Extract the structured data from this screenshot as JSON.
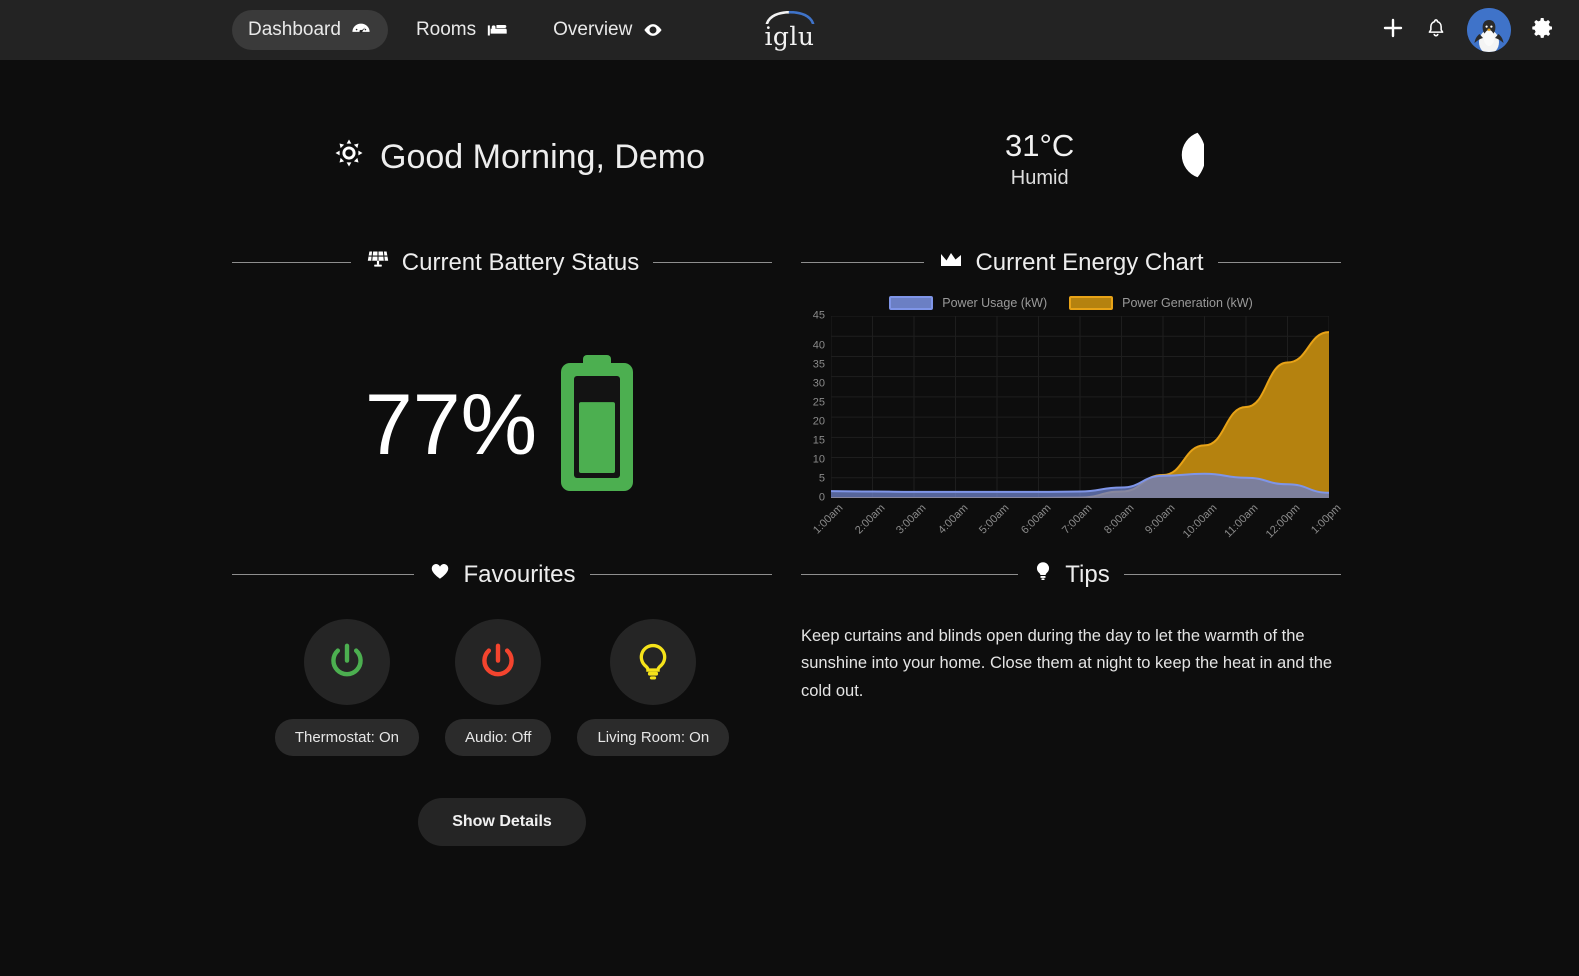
{
  "topbar": {
    "nav": [
      {
        "label": "Dashboard",
        "icon": "gauge-icon",
        "active": true
      },
      {
        "label": "Rooms",
        "icon": "bed-icon",
        "active": false
      },
      {
        "label": "Overview",
        "icon": "eye-icon",
        "active": false
      }
    ],
    "logo_text": "iglu",
    "actions": [
      {
        "name": "add-button",
        "icon": "plus-icon"
      },
      {
        "name": "notifications-button",
        "icon": "bell-icon"
      },
      {
        "name": "profile-avatar",
        "icon": "penguin-avatar"
      },
      {
        "name": "settings-button",
        "icon": "gear-icon"
      }
    ]
  },
  "greeting": {
    "icon": "sun-icon",
    "text": "Good Morning, Demo"
  },
  "weather": {
    "temperature": "31°C",
    "condition": "Humid",
    "icon": "moon-icon"
  },
  "battery": {
    "section_title": "Current Battery Status",
    "section_icon": "solar-panel-icon",
    "percent_label": "77%",
    "percent_value": 77,
    "color": "#4caf50"
  },
  "energy": {
    "section_title": "Current Energy Chart",
    "section_icon": "area-chart-icon"
  },
  "favourites": {
    "section_title": "Favourites",
    "section_icon": "heart-icon",
    "items": [
      {
        "label": "Thermostat: On",
        "icon": "power-icon",
        "color": "#4caf50"
      },
      {
        "label": "Audio: Off",
        "icon": "power-icon",
        "color": "#f4442e"
      },
      {
        "label": "Living Room: On",
        "icon": "lightbulb-icon",
        "color": "#f5e31a"
      }
    ],
    "show_details_label": "Show Details"
  },
  "tips": {
    "section_title": "Tips",
    "section_icon": "lightbulb-icon",
    "text": "Keep curtains and blinds open during the day to let the warmth of the sunshine into your home. Close them at night to keep the heat in and the cold out."
  },
  "chart_data": {
    "type": "area",
    "title": "Current Energy Chart",
    "xlabel": "",
    "ylabel": "",
    "ylim": [
      0,
      45
    ],
    "yticks": [
      0,
      5,
      10,
      15,
      20,
      25,
      30,
      35,
      40,
      45
    ],
    "grid": true,
    "legend_position": "top-center",
    "categories": [
      "1:00am",
      "2:00am",
      "3:00am",
      "4:00am",
      "5:00am",
      "6:00am",
      "7:00am",
      "8:00am",
      "9:00am",
      "10:00am",
      "11:00am",
      "12:00pm",
      "1:00pm"
    ],
    "series": [
      {
        "name": "Power Usage (kW)",
        "color": "#6b7fc4",
        "line_color": "#7f95e8",
        "values": [
          1.7,
          1.6,
          1.5,
          1.5,
          1.5,
          1.5,
          1.6,
          2.6,
          5.5,
          6.0,
          5.0,
          3.4,
          1.3
        ]
      },
      {
        "name": "Power Generation (kW)",
        "color": "#b5820f",
        "line_color": "#e8a317",
        "values": [
          0,
          0,
          0,
          0,
          0,
          0,
          0.1,
          1.6,
          5.7,
          13.0,
          22.5,
          33.5,
          41.0
        ]
      }
    ]
  }
}
